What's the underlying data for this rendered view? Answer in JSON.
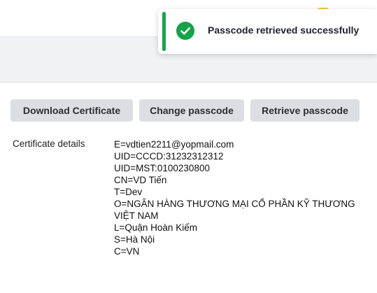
{
  "toast": {
    "message": "Passcode retrieved successfully",
    "icon": "check-circle-icon",
    "accent_color": "#15a34a"
  },
  "actions": {
    "download_label": "Download Certificate",
    "change_label": "Change passcode",
    "retrieve_label": "Retrieve passcode"
  },
  "certificate": {
    "label": "Certificate details",
    "lines": [
      "E=vdtien2211@yopmail.com",
      "UID=CCCD:31232312312",
      "UID=MST:0100230800",
      "CN=VD Tiến",
      "T=Dev",
      "O=NGÂN HÀNG THƯƠNG MẠI CỔ PHẦN KỸ THƯƠNG VIỆT NAM",
      "L=Quận Hoàn Kiếm",
      "S=Hà Nội",
      "C=VN"
    ]
  }
}
